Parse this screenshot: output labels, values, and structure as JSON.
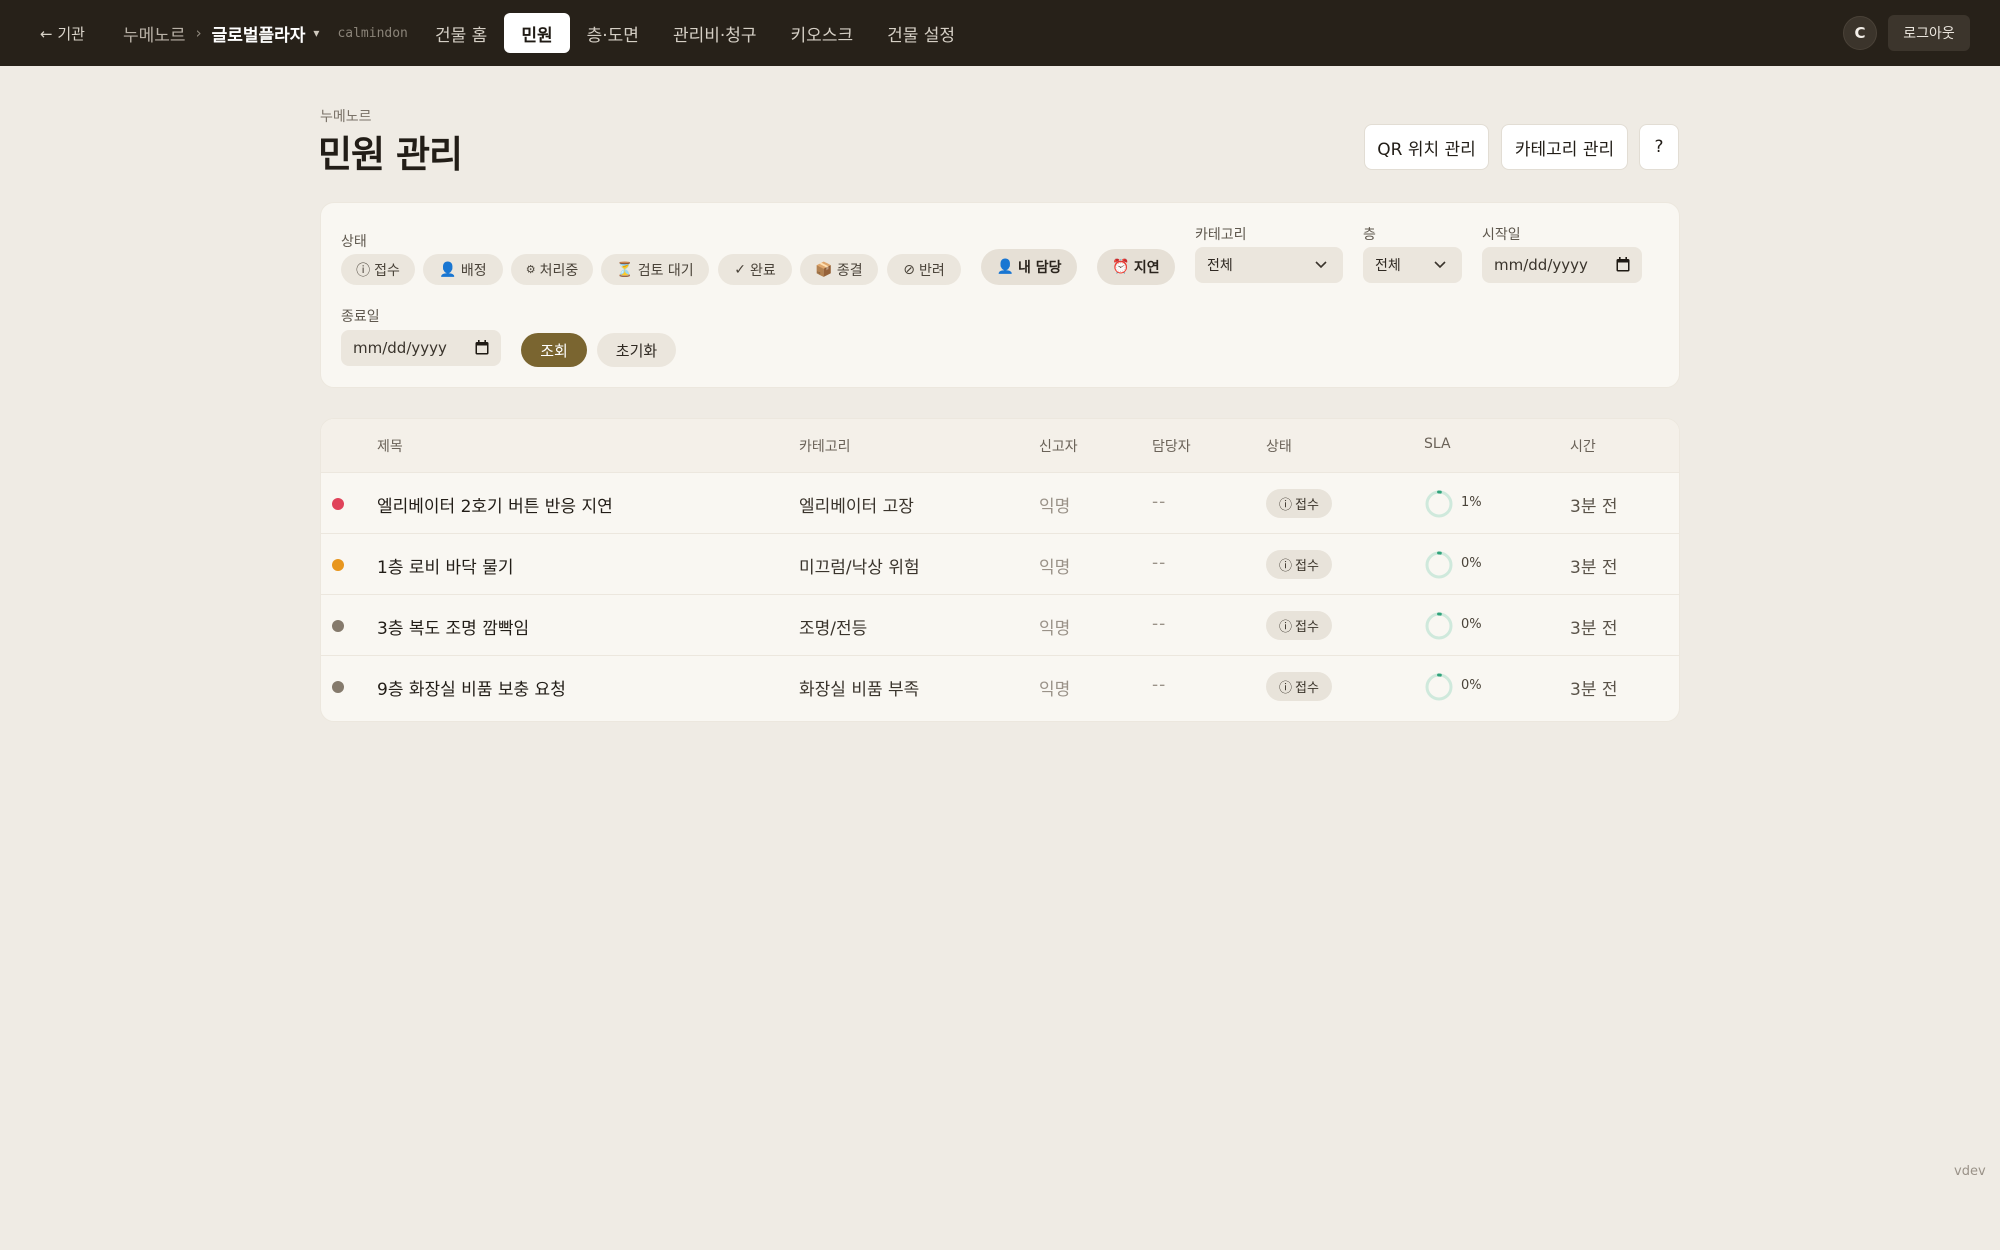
{
  "topbar": {
    "back_label": "← 기관",
    "org": "누메노르",
    "separator": "›",
    "building": "글로벌플라자",
    "building_caret": "▾",
    "slug": "calmindon",
    "nav": [
      {
        "label": "건물 홈",
        "active": false
      },
      {
        "label": "민원",
        "active": true
      },
      {
        "label": "층·도면",
        "active": false
      },
      {
        "label": "관리비·청구",
        "active": false
      },
      {
        "label": "키오스크",
        "active": false
      },
      {
        "label": "건물 설정",
        "active": false
      }
    ],
    "avatar_initial": "C",
    "logout_label": "로그아웃"
  },
  "header": {
    "kicker": "누메노르",
    "title": "민원 관리",
    "buttons": {
      "qr": "QR 위치 관리",
      "category": "카테고리 관리",
      "help": "?"
    }
  },
  "filters": {
    "status_label": "상태",
    "status_chips": [
      {
        "icon": "ⓘ",
        "label": "접수"
      },
      {
        "icon": "👤",
        "label": "배정"
      },
      {
        "icon": "⚙",
        "label": "처리중"
      },
      {
        "icon": "⏳",
        "label": "검토 대기"
      },
      {
        "icon": "✓",
        "label": "완료"
      },
      {
        "icon": "📦",
        "label": "종결"
      },
      {
        "icon": "⊘",
        "label": "반려"
      }
    ],
    "mine_chip": {
      "icon": "👤",
      "label": "내 담당"
    },
    "delay_chip": {
      "icon": "⏰",
      "label": "지연"
    },
    "category_label": "카테고리",
    "category_value": "전체",
    "floor_label": "층",
    "floor_value": "전체",
    "start_label": "시작일",
    "start_placeholder": "mm/dd/yyyy",
    "end_label": "종료일",
    "end_placeholder": "mm/dd/yyyy",
    "search_button": "조회",
    "reset_button": "초기화"
  },
  "table": {
    "columns": {
      "title": "제목",
      "category": "카테고리",
      "reporter": "신고자",
      "assignee": "담당자",
      "status": "상태",
      "sla": "SLA",
      "time": "시간"
    },
    "rows": [
      {
        "priority_color": "#e0435a",
        "title": "엘리베이터 2호기 버튼 반응 지연",
        "category": "엘리베이터 고장",
        "reporter": "익명",
        "assignee": "--",
        "status_icon": "ⓘ",
        "status": "접수",
        "sla_fraction": 0.01,
        "sla_pct": "1%",
        "time": "3분 전"
      },
      {
        "priority_color": "#e8961e",
        "title": "1층 로비 바닥 물기",
        "category": "미끄럼/낙상 위험",
        "reporter": "익명",
        "assignee": "--",
        "status_icon": "ⓘ",
        "status": "접수",
        "sla_fraction": 0.0,
        "sla_pct": "0%",
        "time": "3분 전"
      },
      {
        "priority_color": "#857a6c",
        "title": "3층 복도 조명 깜빡임",
        "category": "조명/전등",
        "reporter": "익명",
        "assignee": "--",
        "status_icon": "ⓘ",
        "status": "접수",
        "sla_fraction": 0.0,
        "sla_pct": "0%",
        "time": "3분 전"
      },
      {
        "priority_color": "#857a6c",
        "title": "9층 화장실 비품 보충 요청",
        "category": "화장실 비품 부족",
        "reporter": "익명",
        "assignee": "--",
        "status_icon": "ⓘ",
        "status": "접수",
        "sla_fraction": 0.0,
        "sla_pct": "0%",
        "time": "3분 전"
      }
    ]
  },
  "footer": {
    "env": "vdev"
  },
  "colors": {
    "topbar_bg": "#272119",
    "page_bg": "#efebe4",
    "accent": "#7a6530",
    "sla_ring": "#cfe9dc",
    "sla_progress": "#2fa27a"
  }
}
